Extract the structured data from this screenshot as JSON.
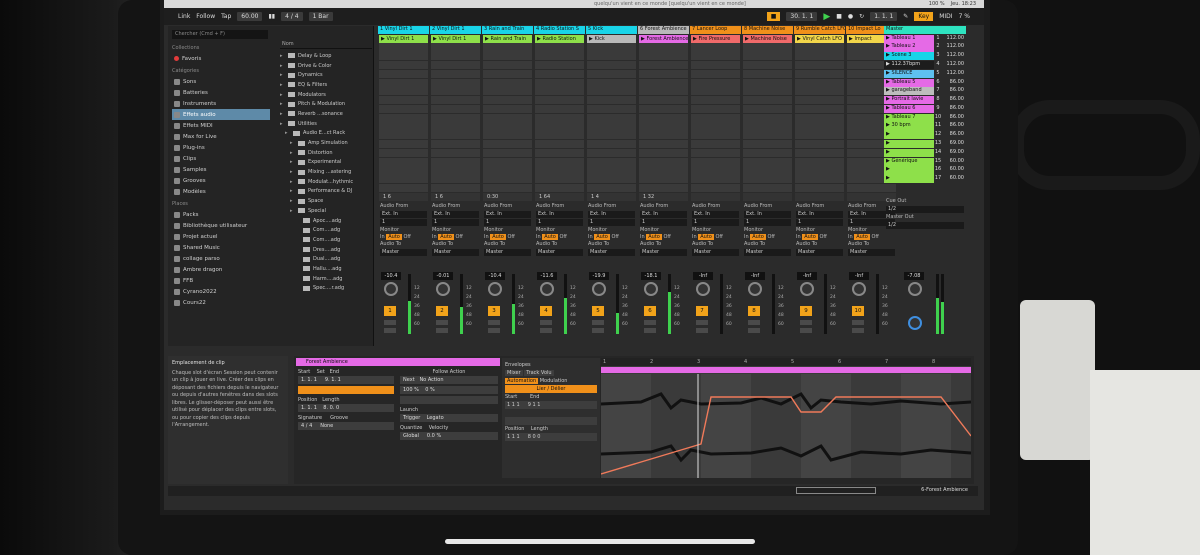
{
  "window": {
    "title": "quelqu'un vient en ce monde [quelqu'un vient en ce monde]",
    "clock": "Jeu. 18:23",
    "battery": "100 %"
  },
  "transport": {
    "link": "Link",
    "follow": "Follow",
    "tap": "Tap",
    "tempo": "60.00",
    "signature": "4 / 4",
    "quantize": "1 Bar",
    "position": "30. 1. 1",
    "loop_start": "1. 1. 1",
    "key": "Key",
    "midi": "MIDI",
    "cpu": "7 %"
  },
  "browser": {
    "search_placeholder": "Chercher (Cmd + F)",
    "collections_label": "Collections",
    "favorites": "Favoris",
    "categories_label": "Catégories",
    "categories": [
      "Sons",
      "Batteries",
      "Instruments",
      "Effets audio",
      "Effets MIDI",
      "Max for Live",
      "Plug-ins",
      "Clips",
      "Samples",
      "Grooves",
      "Modèles"
    ],
    "selected_category": "Effets audio",
    "places_label": "Places",
    "places": [
      "Packs",
      "Bibliothèque utilisateur",
      "Projet actuel",
      "Shared Music",
      "collage parso",
      "Ambre dragon",
      "FFB",
      "Cyrano2022",
      "Cours22"
    ],
    "tree_header": "Nom",
    "tree": [
      {
        "label": "Delay & Loop",
        "depth": 0
      },
      {
        "label": "Drive & Color",
        "depth": 0
      },
      {
        "label": "Dynamics",
        "depth": 0
      },
      {
        "label": "EQ & Filters",
        "depth": 0
      },
      {
        "label": "Modulators",
        "depth": 0
      },
      {
        "label": "Pitch & Modulation",
        "depth": 0
      },
      {
        "label": "Reverb ...sonance",
        "depth": 0
      },
      {
        "label": "Utilities",
        "depth": 0
      },
      {
        "label": "Audio E...ct Rack",
        "depth": 1
      },
      {
        "label": "Amp Simulation",
        "depth": 2
      },
      {
        "label": "Distortion",
        "depth": 2
      },
      {
        "label": "Experimental",
        "depth": 2
      },
      {
        "label": "Mixing ...astering",
        "depth": 2
      },
      {
        "label": "Modulat...hythmic",
        "depth": 2
      },
      {
        "label": "Performance & DJ",
        "depth": 2
      },
      {
        "label": "Space",
        "depth": 2
      },
      {
        "label": "Special",
        "depth": 2
      },
      {
        "label": "Apoc....adg",
        "depth": 3
      },
      {
        "label": "Com....adg",
        "depth": 3
      },
      {
        "label": "Com....adg",
        "depth": 3
      },
      {
        "label": "Dres....adg",
        "depth": 3
      },
      {
        "label": "Dual....adg",
        "depth": 3
      },
      {
        "label": "Hallu....adg",
        "depth": 3
      },
      {
        "label": "Harm....adg",
        "depth": 3
      },
      {
        "label": "Spec....r.adg",
        "depth": 3
      }
    ]
  },
  "tracks": [
    {
      "name": "1 Vinyl Dirt 1",
      "color": "#19d4e8",
      "clip": "Vinyl Dirt 1",
      "clip_color": "#8ee04a",
      "vol": "-10.4",
      "num": "1",
      "meter": 0.55,
      "count": "1 6"
    },
    {
      "name": "2 Vinyl Dirt 1",
      "color": "#19d4e8",
      "clip": "Vinyl Dirt 1",
      "clip_color": "#8ee04a",
      "vol": "-0.01",
      "num": "2",
      "meter": 0.45,
      "count": "1 6"
    },
    {
      "name": "3 Rain and Train",
      "color": "#19d4e8",
      "clip": "Rain and Train",
      "clip_color": "#8ee04a",
      "vol": "-10.4",
      "num": "3",
      "meter": 0.5,
      "count": "0:30"
    },
    {
      "name": "4 Radio Station S",
      "color": "#19d4e8",
      "clip": "Radio Station",
      "clip_color": "#8ee04a",
      "vol": "-11.6",
      "num": "4",
      "meter": 0.6,
      "count": "1 64"
    },
    {
      "name": "5 Kick",
      "color": "#19d4e8",
      "clip": "Kick",
      "clip_color": "#b9b9b9",
      "vol": "-19.9",
      "num": "5",
      "meter": 0.35,
      "count": "1 4"
    },
    {
      "name": "6 Forest Ambience",
      "color": "#b9b9b9",
      "clip": "Forest Ambience",
      "clip_color": "#e56ae6",
      "vol": "-18.1",
      "num": "6",
      "meter": 0.7,
      "count": "1 32"
    },
    {
      "name": "7 Lancer Loop",
      "color": "#f0901a",
      "clip": "Fire Pressure",
      "clip_color": "#f06a6a",
      "vol": "-Inf",
      "num": "7",
      "meter": 0.0,
      "count": ""
    },
    {
      "name": "8 Machine Noise",
      "color": "#f0901a",
      "clip": "Machine Noise",
      "clip_color": "#f06a6a",
      "vol": "-Inf",
      "num": "8",
      "meter": 0.0,
      "count": ""
    },
    {
      "name": "9 Rumble Catch LFO",
      "color": "#f0901a",
      "clip": "Vinyl Catch LFO",
      "clip_color": "#f2d64a",
      "vol": "-Inf",
      "num": "9",
      "meter": 0.0,
      "count": ""
    },
    {
      "name": "10 Impact Lo",
      "color": "#f0901a",
      "clip": "Impact",
      "clip_color": "#f2d64a",
      "vol": "-Inf",
      "num": "10",
      "meter": 0.0,
      "count": ""
    }
  ],
  "io": {
    "audio_from": "Audio From",
    "ext_in": "Ext. In",
    "input_channel": "1",
    "monitor": "Monitor",
    "in": "In",
    "auto": "Auto",
    "off": "Off",
    "audio_to": "Audio To",
    "master": "Master",
    "scale": [
      "12",
      "24",
      "36",
      "48",
      "60"
    ]
  },
  "master": {
    "name": "Master",
    "color": "#2ee3c0",
    "scenes": [
      {
        "name": "Tableau 1",
        "color": "#e56ae6",
        "num": "1",
        "bpm": "112.00"
      },
      {
        "name": "Tableau 2",
        "color": "#e56ae6",
        "num": "2",
        "bpm": "112.00"
      },
      {
        "name": "Scène 3",
        "color": "#19d4e8",
        "num": "3",
        "bpm": "112.00"
      },
      {
        "name": "112.37bpm",
        "color": "#1d1d1d",
        "num": "4",
        "bpm": "112.00"
      },
      {
        "name": "SILENCE",
        "color": "#5ec1f0",
        "num": "5",
        "bpm": "112.00"
      },
      {
        "name": "Tableau 5",
        "color": "#e56ae6",
        "num": "6",
        "bpm": "86.00"
      },
      {
        "name": "garageband",
        "color": "#bdbdbd",
        "num": "7",
        "bpm": "86.00"
      },
      {
        "name": "Portrait lavie",
        "color": "#e56ae6",
        "num": "8",
        "bpm": "86.00"
      },
      {
        "name": "Tableau 6",
        "color": "#e56ae6",
        "num": "9",
        "bpm": "86.00"
      },
      {
        "name": "Tableau 7",
        "color": "#8ee04a",
        "num": "10",
        "bpm": "86.00"
      },
      {
        "name": "30 bpm",
        "color": "#8ee04a",
        "num": "11",
        "bpm": "86.00"
      },
      {
        "name": "",
        "color": "#8ee04a",
        "num": "12",
        "bpm": "86.00"
      },
      {
        "name": "",
        "color": "#8ee04a",
        "num": "13",
        "bpm": "69.00"
      },
      {
        "name": "",
        "color": "#8ee04a",
        "num": "14",
        "bpm": "69.00"
      },
      {
        "name": "Générique",
        "color": "#8ee04a",
        "num": "15",
        "bpm": "60.00"
      },
      {
        "name": "",
        "color": "#8ee04a",
        "num": "16",
        "bpm": "60.00"
      },
      {
        "name": "",
        "color": "#8ee04a",
        "num": "17",
        "bpm": "60.00"
      }
    ],
    "cue_out": "Cue Out",
    "cue_value": "1/2",
    "master_out": "Master Out",
    "master_value": "1/2",
    "vol": "-7.08"
  },
  "info": {
    "title": "Emplacement de clip",
    "text": "Chaque slot d'écran Session peut contenir un clip à jouer en live. Créer des clips en déposant des fichiers depuis le navigateur ou depuis d'autres fenêtres dans des slots libres. Le glisser-déposer peut aussi être utilisé pour déplacer des clips entre slots, ou pour copier des clips depuis l'Arrangement."
  },
  "clip": {
    "name": "Forest Ambience",
    "start_label": "Start",
    "set_label": "Set",
    "end_label": "End",
    "start": "1. 1. 1",
    "end": "9. 1. 1",
    "position_label": "Position",
    "length_label": "Length",
    "position": "1. 1. 1",
    "length": "8. 0. 0",
    "signature_label": "Signature",
    "sig_num": "4",
    "sig_den": "4",
    "groove_label": "Groove",
    "groove": "None",
    "follow_action": "Follow Action",
    "next": "Next",
    "no_action": "No Action",
    "chance": "100 %",
    "chance2": "0 %",
    "launch": "Launch",
    "trigger": "Trigger",
    "legato": "Legato",
    "quantize": "Quantize",
    "velocity": "Velocity",
    "global": "Global",
    "velocity_value": "0.0 %"
  },
  "envelopes": {
    "title": "Envelopes",
    "mixer": "Mixer",
    "track_volume": "Track Volu",
    "automation": "Automation",
    "modulation": "Modulation",
    "link_button": "Lier / Délier",
    "start_label": "Start",
    "end_label": "End",
    "position_label": "Position",
    "length_label": "Length",
    "start": "1 1 1",
    "end": "9 1 1",
    "position": "1 1 1",
    "length": "8 0 0"
  },
  "ruler": [
    "1",
    "2",
    "3",
    "4",
    "5",
    "6",
    "7",
    "8"
  ],
  "status": {
    "track_label": "6-Forest Ambience"
  }
}
